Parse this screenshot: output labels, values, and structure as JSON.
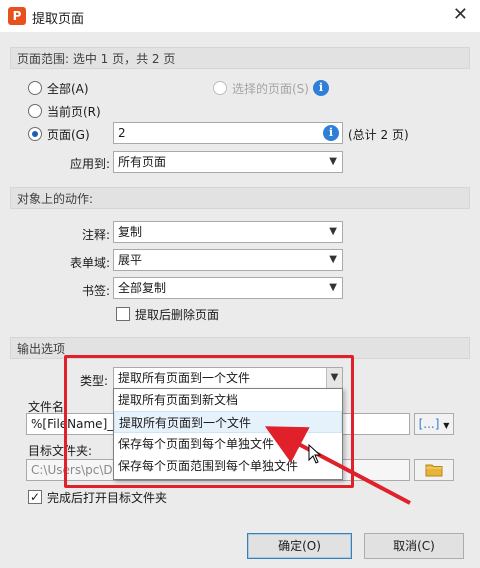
{
  "window": {
    "title": "提取页面",
    "app_icon_letter": "P",
    "close_glyph": "✕"
  },
  "page_range": {
    "header": "页面范围: 选中 1 页，共 2 页",
    "all_label": "全部(A)",
    "selected_label": "选择的页面(S)",
    "current_label": "当前页(R)",
    "pages_label": "页面(G)",
    "pages_value": "2",
    "total_label": "(总计 2 页)",
    "apply_label": "应用到:",
    "apply_value": "所有页面"
  },
  "object_actions": {
    "header": "对象上的动作:",
    "annot_label": "注释:",
    "annot_value": "复制",
    "form_label": "表单域:",
    "form_value": "展平",
    "bookmark_label": "书签:",
    "bookmark_value": "全部复制",
    "delete_after_label": "提取后删除页面"
  },
  "output": {
    "header": "输出选项",
    "type_label": "类型:",
    "type_value": "提取所有页面到一个文件",
    "filename_label": "文件名",
    "filename_value": "%[FileName]_%",
    "filename_button": "[...]",
    "target_label": "目标文件夹:",
    "target_value": "C:\\Users\\pc\\D",
    "open_after_label": "完成后打开目标文件夹",
    "options": [
      "提取所有页面到新文档",
      "提取所有页面到一个文件",
      "保存每个页面到每个单独文件",
      "保存每个页面范围到每个单独文件"
    ]
  },
  "buttons": {
    "ok": "确定(O)",
    "cancel": "取消(C)"
  },
  "icons": {
    "info": "i",
    "dropdown": "▼",
    "folder": "folder-icon"
  },
  "colors": {
    "highlight": "#e0202a",
    "accent": "#2f7fd8",
    "brand": "#e8511d"
  }
}
